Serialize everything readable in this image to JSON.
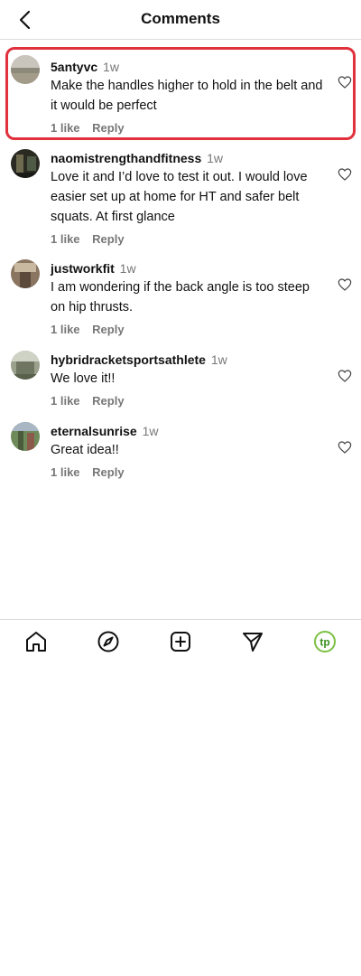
{
  "header": {
    "title": "Comments",
    "back_icon": "chevron-left-icon"
  },
  "comments": [
    {
      "username": "5antyvc",
      "time": "1w",
      "text": "Make the handles higher to hold in the belt and it would be perfect",
      "likes": "1 like",
      "reply": "Reply",
      "highlighted": true
    },
    {
      "username": "naomistrengthandfitness",
      "time": "1w",
      "text": "Love it and I’d love to test it out. I would love easier set up at home for HT and safer belt squats. At first glance",
      "likes": "1 like",
      "reply": "Reply"
    },
    {
      "username": "justworkfit",
      "time": "1w",
      "text": "I am wondering if the back angle is too steep on hip thrusts.",
      "likes": "1 like",
      "reply": "Reply"
    },
    {
      "username": "hybridracketsportsathlete",
      "time": "1w",
      "text": "We love it!!",
      "likes": "1 like",
      "reply": "Reply"
    },
    {
      "username": "eternalsunrise",
      "time": "1w",
      "text": "Great idea!!",
      "likes": "1 like",
      "reply": "Reply"
    }
  ],
  "nav": {
    "items": [
      "home-icon",
      "explore-icon",
      "create-icon",
      "direct-message-icon",
      "profile-icon"
    ],
    "profile_text": "tp"
  },
  "colors": {
    "highlight_border": "#e0313d",
    "profile_accent": "#7bc043"
  }
}
